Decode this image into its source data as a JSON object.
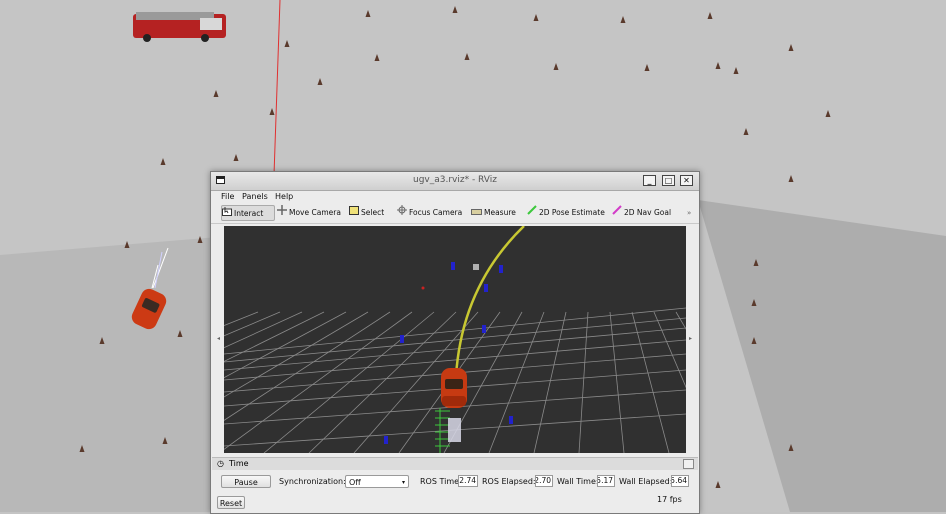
{
  "window": {
    "title": "ugv_a3.rviz* - RViz",
    "controls": [
      "minimize",
      "maximize",
      "close"
    ]
  },
  "menu": {
    "file": "File",
    "panels": "Panels",
    "help": "Help"
  },
  "toolbar": {
    "interact": "Interact",
    "move_camera": "Move Camera",
    "select": "Select",
    "focus_camera": "Focus Camera",
    "measure": "Measure",
    "pose_estimate": "2D Pose Estimate",
    "nav_goal": "2D Nav Goal",
    "more": "»"
  },
  "time_panel": {
    "header": "Time",
    "pause_label": "Pause",
    "sync_label": "Synchronization:",
    "sync_value": "Off",
    "ros_time_label": "ROS Time:",
    "ros_time_value": "2.74",
    "ros_elapsed_label": "ROS Elapsed:",
    "ros_elapsed_value": "2.70",
    "wall_time_label": "Wall Time:",
    "wall_time_value": "5.17",
    "wall_elapsed_label": "Wall Elapsed:",
    "wall_elapsed_value": "5.64",
    "reset_label": "Reset",
    "fps": "17 fps"
  },
  "colors": {
    "sim_ground": "#c4c4c4",
    "viewport_bg": "#303030",
    "grid": "#8a8a8a",
    "path": "#c8c832",
    "car": "#c63a12",
    "pose_estimate": "#3cc83c",
    "nav_goal": "#d23cc8"
  }
}
